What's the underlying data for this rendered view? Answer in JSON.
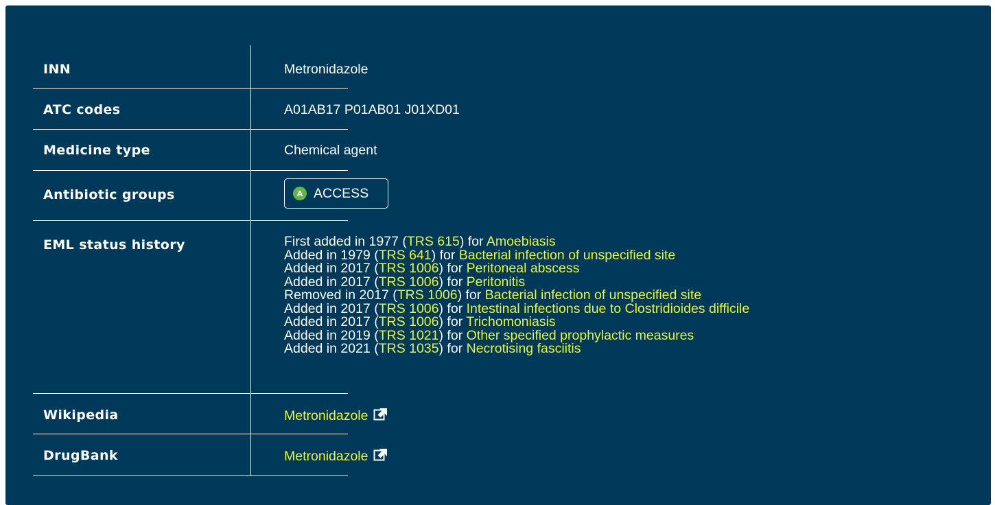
{
  "rows": {
    "inn": {
      "label": "INN",
      "value": "Metronidazole"
    },
    "atc": {
      "label": "ATC codes",
      "value": "A01AB17 P01AB01 J01XD01"
    },
    "type": {
      "label": "Medicine type",
      "value": "Chemical agent"
    },
    "groups": {
      "label": "Antibiotic groups",
      "badge_letter": "A",
      "badge_text": "ACCESS",
      "badge_color": "#62b64a"
    },
    "history": {
      "label": "EML status history",
      "entries": [
        {
          "prefix": "First added in 1977 (",
          "trs": "TRS 615",
          "mid": ") for ",
          "indication": "Amoebiasis"
        },
        {
          "prefix": "Added in 1979 (",
          "trs": "TRS 641",
          "mid": ") for ",
          "indication": "Bacterial infection of unspecified site"
        },
        {
          "prefix": "Added in 2017 (",
          "trs": "TRS 1006",
          "mid": ") for ",
          "indication": "Peritoneal abscess"
        },
        {
          "prefix": "Added in 2017 (",
          "trs": "TRS 1006",
          "mid": ") for ",
          "indication": "Peritonitis"
        },
        {
          "prefix": "Removed in 2017 (",
          "trs": "TRS 1006",
          "mid": ") for ",
          "indication": "Bacterial infection of unspecified site"
        },
        {
          "prefix": "Added in 2017 (",
          "trs": "TRS 1006",
          "mid": ") for ",
          "indication": "Intestinal infections due to Clostridioides difficile"
        },
        {
          "prefix": "Added in 2017 (",
          "trs": "TRS 1006",
          "mid": ") for ",
          "indication": "Trichomoniasis"
        },
        {
          "prefix": "Added in 2019 (",
          "trs": "TRS 1021",
          "mid": ") for ",
          "indication": "Other specified prophylactic measures"
        },
        {
          "prefix": "Added in 2021 (",
          "trs": "TRS 1035",
          "mid": ") for ",
          "indication": "Necrotising fasciitis"
        }
      ]
    },
    "wikipedia": {
      "label": "Wikipedia",
      "link": "Metronidazole",
      "icon": "external-link-icon"
    },
    "drugbank": {
      "label": "DrugBank",
      "link": "Metronidazole",
      "icon": "external-link-icon"
    }
  },
  "colors": {
    "background": "#00395a",
    "link": "#e8f53a",
    "text": "#ffffff",
    "access": "#62b64a"
  }
}
